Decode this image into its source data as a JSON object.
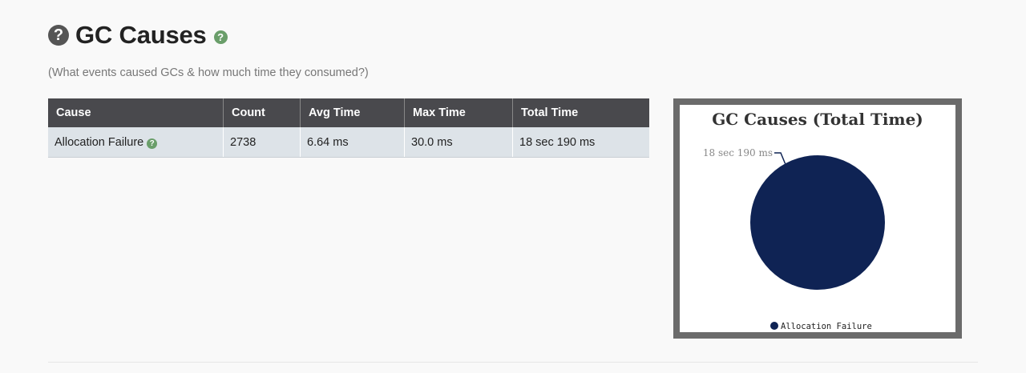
{
  "header": {
    "title": "GC Causes",
    "help_icon_glyph": "?",
    "subtitle": "(What events caused GCs & how much time they consumed?)"
  },
  "table": {
    "columns": [
      "Cause",
      "Count",
      "Avg Time",
      "Max Time",
      "Total Time"
    ],
    "rows": [
      {
        "cause": "Allocation Failure",
        "count": "2738",
        "avg_time": "6.64 ms",
        "max_time": "30.0 ms",
        "total_time": "18 sec 190 ms"
      }
    ]
  },
  "chart": {
    "title": "GC Causes (Total Time)",
    "slice_label": "18 sec 190 ms",
    "legend_label": "Allocation Failure"
  },
  "chart_data": {
    "type": "pie",
    "title": "GC Causes (Total Time)",
    "categories": [
      "Allocation Failure"
    ],
    "values": [
      18.19
    ],
    "units": "sec",
    "data_labels": [
      "18 sec 190 ms"
    ],
    "colors": [
      "#0f2354"
    ],
    "legend_placement": "bottom"
  },
  "colors": {
    "header_bg": "#49494d",
    "row_bg": "#dde3e8",
    "help_green": "#6a9e6a",
    "pie_fill": "#0f2354"
  }
}
